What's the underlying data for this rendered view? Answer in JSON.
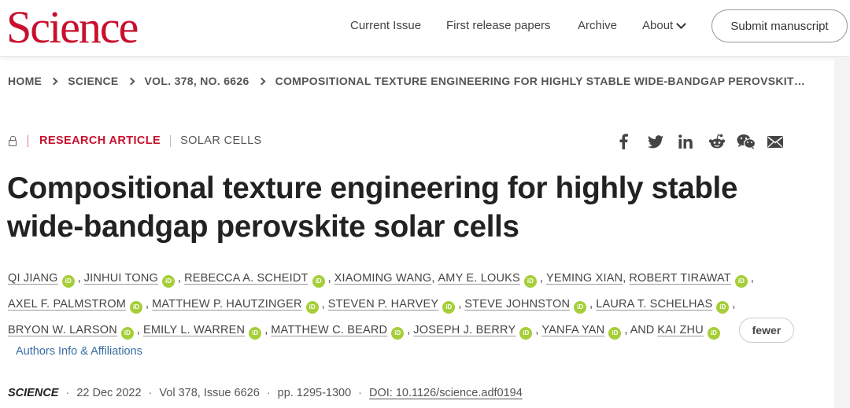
{
  "header": {
    "logo": "Science",
    "nav": {
      "current_issue": "Current Issue",
      "first_release": "First release papers",
      "archive": "Archive",
      "about": "About"
    },
    "submit": "Submit manuscript"
  },
  "breadcrumb": [
    "HOME",
    "SCIENCE",
    "VOL. 378, NO. 6626",
    "COMPOSITIONAL TEXTURE ENGINEERING FOR HIGHLY STABLE WIDE-BANDGAP PEROVSKIT…"
  ],
  "article": {
    "type": "RESEARCH ARTICLE",
    "subject": "SOLAR CELLS",
    "title": "Compositional texture engineering for highly stable wide-bandgap perovskite solar cells",
    "authors_line1": [
      {
        "name": "QI JIANG",
        "orcid": true
      },
      {
        "name": "JINHUI TONG",
        "orcid": true
      },
      {
        "name": "REBECCA A. SCHEIDT",
        "orcid": true
      },
      {
        "name": "XIAOMING WANG",
        "orcid": false
      },
      {
        "name": "AMY E. LOUKS",
        "orcid": true
      },
      {
        "name": "YEMING XIAN",
        "orcid": false
      },
      {
        "name": "ROBERT TIRAWAT",
        "orcid": true
      }
    ],
    "authors_line2": [
      {
        "name": "AXEL F. PALMSTROM",
        "orcid": true
      },
      {
        "name": "MATTHEW P. HAUTZINGER",
        "orcid": true
      },
      {
        "name": "STEVEN P. HARVEY",
        "orcid": true
      },
      {
        "name": "STEVE JOHNSTON",
        "orcid": true
      },
      {
        "name": "LAURA T. SCHELHAS",
        "orcid": true
      }
    ],
    "authors_line3": [
      {
        "name": "BRYON W. LARSON",
        "orcid": true
      },
      {
        "name": "EMILY L. WARREN",
        "orcid": true
      },
      {
        "name": "MATTHEW C. BEARD",
        "orcid": true
      },
      {
        "name": "JOSEPH J. BERRY",
        "orcid": true
      },
      {
        "name": "YANFA YAN",
        "orcid": true
      },
      {
        "name": "KAI ZHU",
        "orcid": true
      }
    ],
    "and_text": "AND",
    "orcid_badge": "iD",
    "fewer": "fewer",
    "affiliations": "Authors Info & Affiliations"
  },
  "citation": {
    "journal": "SCIENCE",
    "date": "22 Dec 2022",
    "volume": "Vol 378, Issue 6626",
    "pages": "pp. 1295-1300",
    "doi": "DOI: 10.1126/science.adf0194"
  },
  "share_icons": [
    "facebook-icon",
    "twitter-icon",
    "linkedin-icon",
    "reddit-icon",
    "wechat-icon",
    "email-icon"
  ],
  "colors": {
    "brand": "#c8102e",
    "orcid": "#a6ce39",
    "link": "#3a6ea5"
  }
}
